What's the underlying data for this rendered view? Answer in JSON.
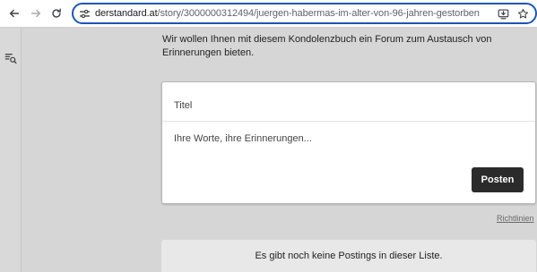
{
  "browser": {
    "url_host": "derstandard.at",
    "url_path": "/story/3000000312494/juergen-habermas-im-alter-von-96-jahren-gestorben",
    "back_icon": "arrow-left-icon",
    "forward_icon": "arrow-right-icon",
    "reload_icon": "reload-icon",
    "site_info_icon": "tune-icon",
    "install_icon": "install-app-icon",
    "bookmark_icon": "star-icon",
    "focus_color": "#1a56b3"
  },
  "page": {
    "intro_text": "Wir wollen Ihnen mit diesem Kondolenzbuch ein Forum zum Austausch von Erinnerungen bieten.",
    "form": {
      "title_placeholder": "Titel",
      "body_placeholder": "Ihre Worte, ihre Erinnerungen...",
      "submit_label": "Posten"
    },
    "guidelines_label": "Richtlinien",
    "empty_message": "Es gibt noch keine Postings in dieser Liste."
  }
}
